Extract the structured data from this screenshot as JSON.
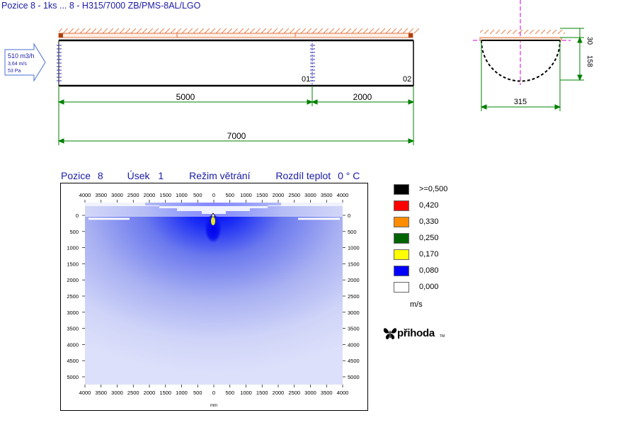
{
  "header": {
    "title": "Pozice 8 - 1ks ... 8 - H315/7000 ZB/PMS-8AL/LGO"
  },
  "inlet": {
    "flow": "510 m3/h",
    "velocity": "3,64 m/s",
    "pressure": "53 Pa"
  },
  "duct": {
    "outlet_labels": [
      "01",
      "02"
    ],
    "segment_dims": [
      "5000",
      "2000"
    ],
    "total_dim": "7000",
    "cross_section": {
      "top_gap": "30",
      "height": "158",
      "diameter": "315"
    }
  },
  "section": {
    "pozice_label": "Pozice",
    "pozice_value": "8",
    "usek_label": "Úsek",
    "usek_value": "1",
    "mode": "Režim větrání",
    "diff_label": "Rozdíl teplot",
    "diff_value": "0 ° C"
  },
  "plot": {
    "x_ticks": [
      "4000",
      "3500",
      "3000",
      "2500",
      "2000",
      "1500",
      "1000",
      "500",
      "0",
      "500",
      "1000",
      "1500",
      "2000",
      "2500",
      "3000",
      "3500",
      "4000"
    ],
    "y_ticks": [
      "0",
      "500",
      "1000",
      "1500",
      "2000",
      "2500",
      "3000",
      "3500",
      "4000",
      "4500",
      "5000"
    ],
    "x_unit": "mm"
  },
  "legend": {
    "items": [
      {
        "label": ">=0,500",
        "color": "#000000"
      },
      {
        "label": "0,420",
        "color": "#ff0000"
      },
      {
        "label": "0,330",
        "color": "#ff8c00"
      },
      {
        "label": "0,250",
        "color": "#006400"
      },
      {
        "label": "0,170",
        "color": "#ffff00"
      },
      {
        "label": "0,080",
        "color": "#0000ff"
      },
      {
        "label": "0,000",
        "color": "#ffffff"
      }
    ],
    "unit": "m/s"
  },
  "brand": {
    "name": "přihoda"
  },
  "colors": {
    "title": "#1a1aa8",
    "dimension": "#008000",
    "duct": "#000000",
    "ceiling": "#e8824a",
    "axis": "#d400d4"
  }
}
